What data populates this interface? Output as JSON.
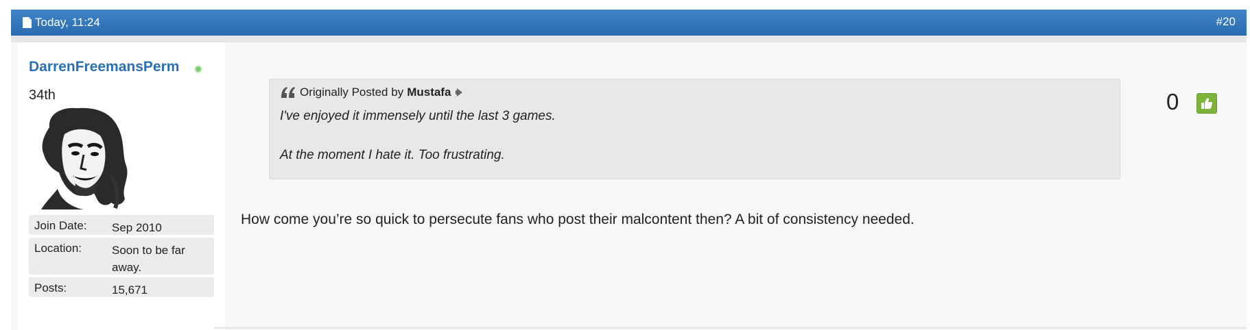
{
  "post_header": {
    "date": "Today, 11:24",
    "post_number": "#20"
  },
  "user": {
    "username": "DarrenFreemansPerm",
    "status": "online",
    "rank": "34th",
    "details": [
      {
        "label": "Join Date:",
        "value": "Sep 2010"
      },
      {
        "label": "Location:",
        "value": "Soon to be far away."
      },
      {
        "label": "Posts:",
        "value": "15,671"
      }
    ]
  },
  "quote": {
    "prefix": "Originally Posted by",
    "author": "Mustafa",
    "lines": [
      "I've enjoyed it immensely until the last 3 games.",
      "At the moment I hate it. Too frustrating."
    ]
  },
  "message": "How come you’re so quick to persecute fans who post their malcontent then? A bit of consistency needed.",
  "likes": {
    "count": "0"
  },
  "icons": {
    "date": "document-icon",
    "online": "online-status-icon",
    "quote": "quote-icon",
    "quote_link": "view-post-arrow-icon",
    "like": "thumbs-up-icon"
  },
  "colors": {
    "header_blue": "#2b6bb0",
    "username": "#2b6fb5",
    "like_green": "#7db33a",
    "online": "#7ccf74"
  }
}
